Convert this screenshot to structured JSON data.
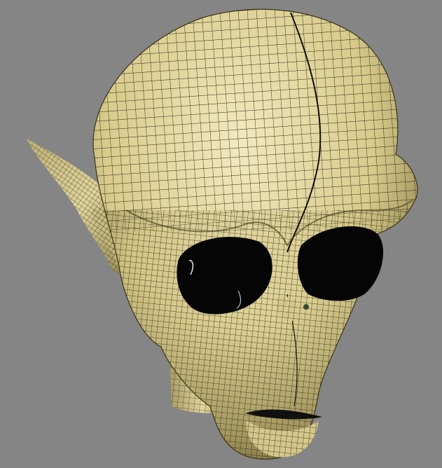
{
  "viewport": {
    "background_color": "#858585",
    "model": {
      "name": "alien-head-wireframe-mesh",
      "surface_color": "#e4d8a0",
      "shadow_color": "#6b6236",
      "wire_color": "#2b2614",
      "cavity_color": "#050505"
    }
  }
}
